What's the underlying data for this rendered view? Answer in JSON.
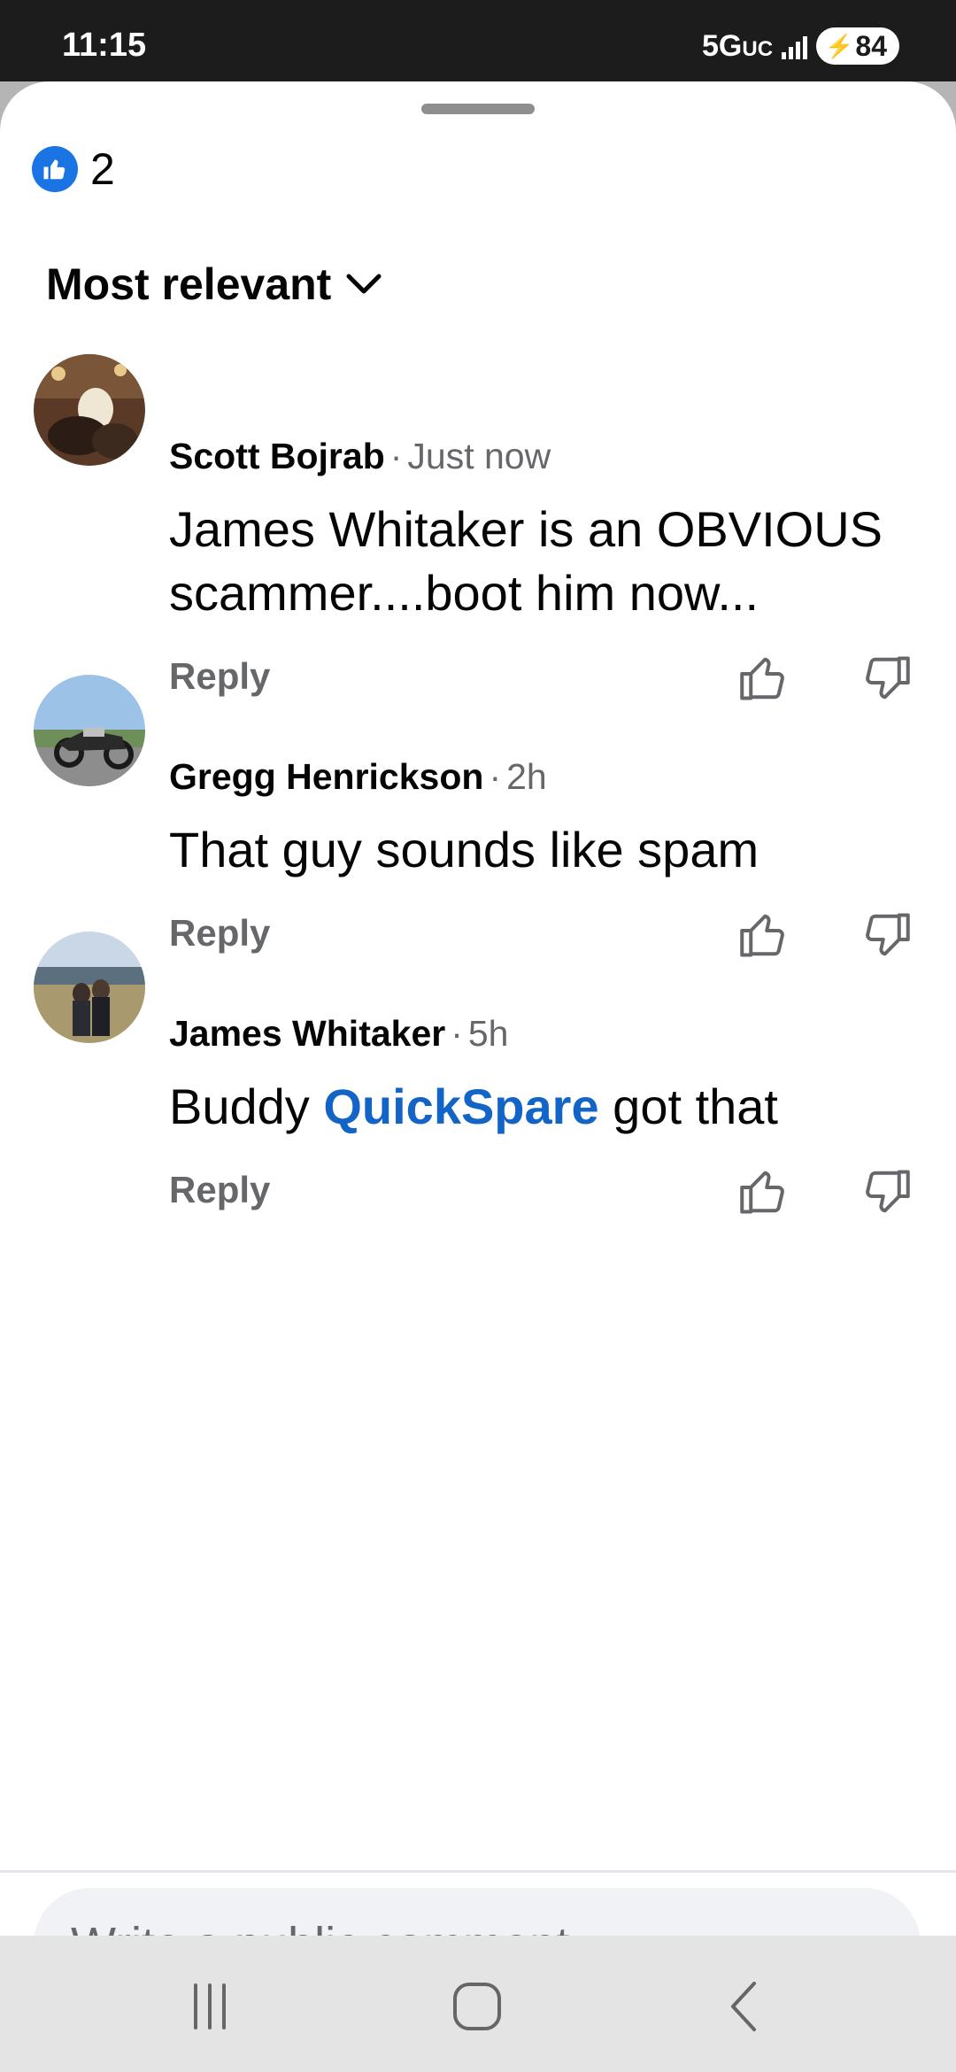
{
  "status": {
    "time": "11:15",
    "network": "5G",
    "network_suffix": "UC",
    "battery": "84"
  },
  "reactions": {
    "icon": "like-icon",
    "count": "2"
  },
  "sort": {
    "label": "Most relevant"
  },
  "comments": [
    {
      "author": "Scott Bojrab",
      "time": "Just now",
      "text": "James Whitaker is an OBVIOUS scammer....boot him now...",
      "reply_label": "Reply"
    },
    {
      "author": "Gregg Henrickson",
      "time": "2h",
      "text": "That guy sounds like spam",
      "reply_label": "Reply"
    },
    {
      "author": "James Whitaker",
      "time": "5h",
      "text_before": "Buddy ",
      "mention": "QuickSpare",
      "text_after": " got that",
      "reply_label": "Reply"
    }
  ],
  "composer": {
    "placeholder": "Write a public comment…"
  },
  "colors": {
    "accent": "#1b74e4",
    "mention": "#1264c6",
    "secondary_text": "#65676b"
  }
}
